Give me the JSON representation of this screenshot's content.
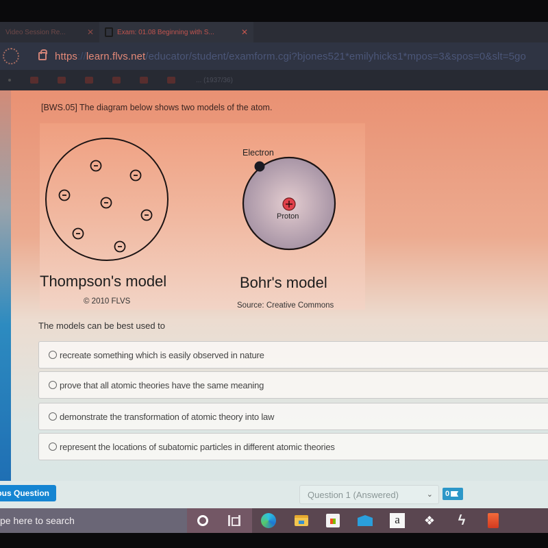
{
  "browser": {
    "tabs": [
      {
        "label": "Video Session Re...",
        "active": false
      },
      {
        "label": "Exam: 01.08 Beginning with S...",
        "active": true
      }
    ],
    "url": {
      "scheme": "https",
      "sep": "://",
      "host": "learn.flvs.net",
      "path": "/educator/student/examform.cgi?bjones521*emilyhicks1*mpos=3&spos=0&slt=5go"
    },
    "bookmarks_text": "... (1937/36)"
  },
  "question": {
    "prompt": "[BWS.05] The diagram below shows two models of the atom.",
    "figure": {
      "left_model_title": "Thompson's model",
      "left_caption": "© 2010 FLVS",
      "right_model_title": "Bohr's model",
      "right_caption": "Source: Creative Commons",
      "electron_label": "Electron",
      "proton_label": "Proton",
      "electron_symbol": "−",
      "proton_symbol": "+"
    },
    "stem": "The models can be best used to",
    "options": [
      {
        "label": "recreate something which is easily observed in nature",
        "selected": false
      },
      {
        "label": "prove that all atomic theories have the same meaning",
        "selected": false
      },
      {
        "label": "demonstrate the transformation of atomic theory into law",
        "selected": false
      },
      {
        "label": "represent the locations of subatomic particles in different atomic theories",
        "selected": false
      }
    ]
  },
  "navigation": {
    "previous_button": "ious Question",
    "question_select": "Question 1 (Answered)",
    "flag_count": "0"
  },
  "taskbar": {
    "search_placeholder": "pe here to search",
    "apps": [
      "cortana",
      "task-view",
      "edge",
      "file-explorer",
      "microsoft-store",
      "mail",
      "amazon",
      "dropbox",
      "bolt",
      "office"
    ],
    "amazon_glyph": "a",
    "dropbox_glyph": "❖",
    "bolt_glyph": "ϟ"
  }
}
